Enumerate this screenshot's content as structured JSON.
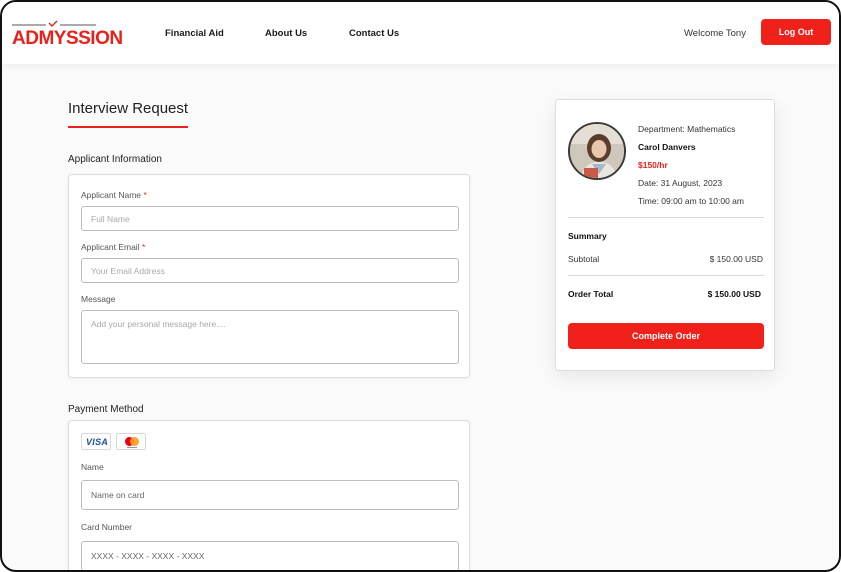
{
  "brand": {
    "name": "ADMYSSION",
    "color": "#e8221b"
  },
  "nav": {
    "links": [
      {
        "label": "Financial Aid"
      },
      {
        "label": "About Us"
      },
      {
        "label": "Contact Us"
      }
    ],
    "welcome": "Welcome Tony",
    "logout_label": "Log Out"
  },
  "page": {
    "title": "Interview Request"
  },
  "applicant": {
    "heading": "Applicant Information",
    "name_label": "Applicant Name",
    "name_placeholder": "Full Name",
    "email_label": "Applicant Email",
    "email_placeholder": "Your Email Address",
    "message_label": "Message",
    "message_placeholder": "Add your personal message here....",
    "required_mark": "*"
  },
  "payment": {
    "heading": "Payment Method",
    "cards": [
      "visa-icon",
      "mastercard-icon"
    ],
    "visa_text": "VISA",
    "name_label": "Name",
    "name_placeholder": "Name on card",
    "card_label": "Card Number",
    "card_placeholder": "XXXX - XXXX - XXXX - XXXX"
  },
  "order": {
    "department": "Department: Mathematics",
    "tutor_name": "Carol Danvers",
    "rate": "$150/hr",
    "date": "Date: 31 August, 2023",
    "time": "Time: 09:00 am to 10:00 am",
    "summary_label": "Summary",
    "subtotal_label": "Subtotal",
    "subtotal_value": "$ 150.00 USD",
    "total_label": "Order Total",
    "total_value": "$ 150.00 USD",
    "complete_label": "Complete Order"
  },
  "colors": {
    "accent": "#f0211a"
  }
}
